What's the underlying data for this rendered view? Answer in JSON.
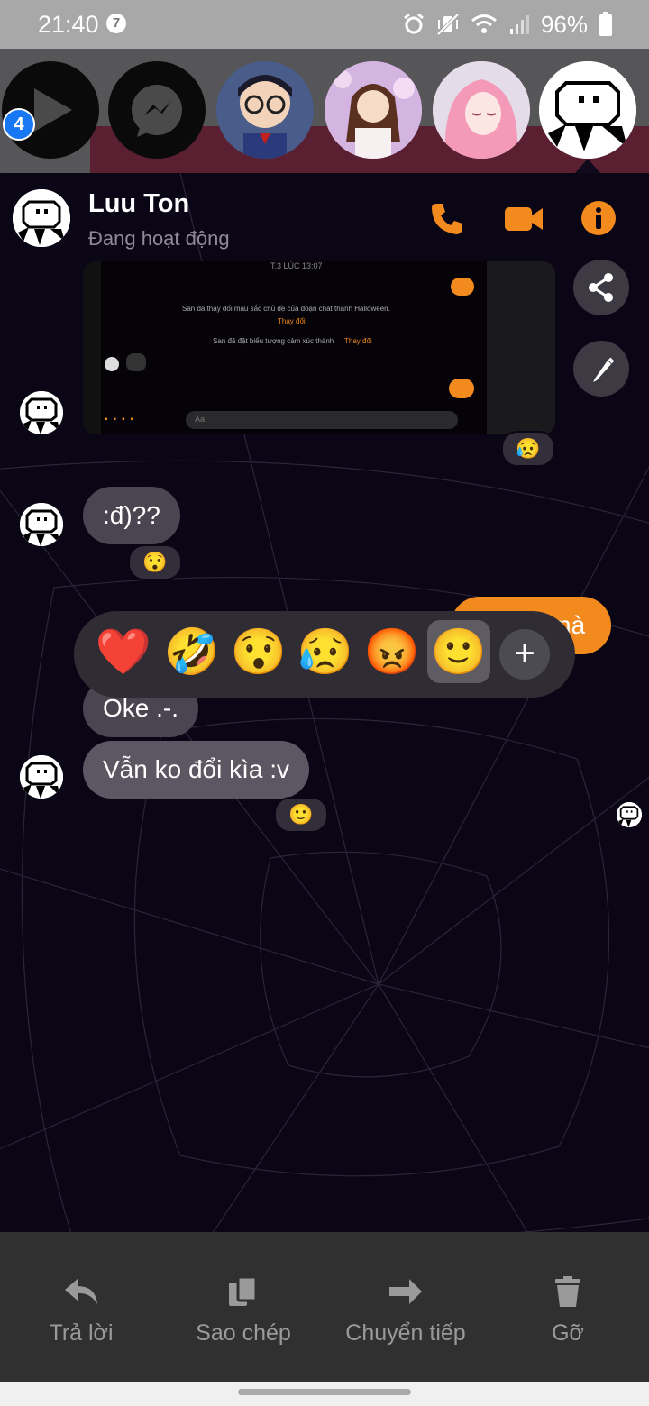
{
  "status_bar": {
    "time": "21:40",
    "notification_count": "7",
    "battery": "96%"
  },
  "chat_heads": {
    "badge_count": "4"
  },
  "header": {
    "name": "Luu Ton",
    "status": "Đang hoạt động"
  },
  "shared_screenshot": {
    "timestamp": "T.3 LÚC 13:07",
    "system_msg_1": "San đã thay đổi màu sắc chủ đề của đoạn chat thành Halloween.",
    "change_link": "Thay đổi",
    "system_msg_2": "San đã đặt biểu tượng cảm xúc thành",
    "change_link_2": "Thay đổi",
    "input_placeholder": "Aa",
    "reaction": "😥"
  },
  "messages": [
    {
      "text": ":đ)??",
      "reaction": "😯"
    },
    {
      "text": "nà",
      "outgoing": true
    },
    {
      "text": "Oke .-."
    },
    {
      "text": "Vẫn ko đổi kìa :v",
      "reaction": "🙂"
    }
  ],
  "reaction_picker": {
    "options": [
      "❤️",
      "🤣",
      "😯",
      "😥",
      "😡",
      "🙂"
    ],
    "selected": "🙂",
    "more_label": "+"
  },
  "action_bar": {
    "reply": "Trả lời",
    "copy": "Sao chép",
    "forward": "Chuyển tiếp",
    "remove": "Gỡ"
  },
  "colors": {
    "accent": "#f28a1e",
    "bubble": "#4a4550",
    "badge": "#1877f2"
  }
}
